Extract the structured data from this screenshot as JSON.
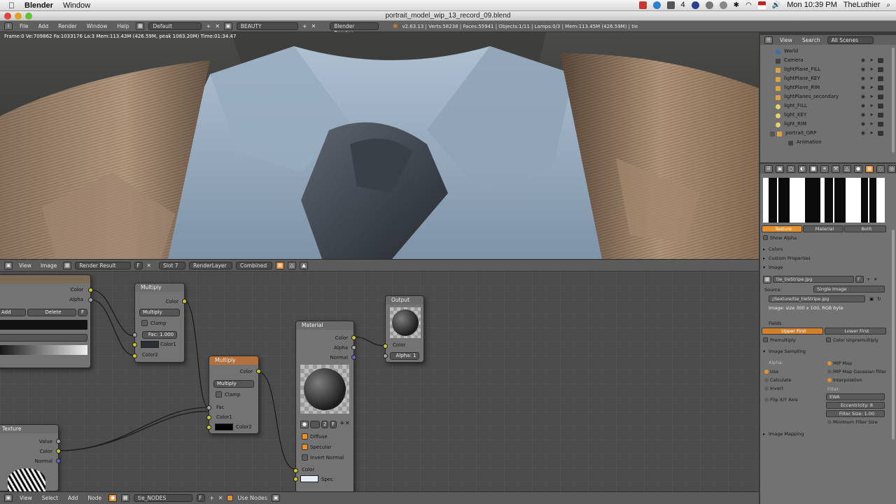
{
  "menubar": {
    "app": "Blender",
    "menus": [
      "Window"
    ],
    "clock": "Mon 10:39 PM",
    "user": "TheLuthier",
    "tray_number": "4"
  },
  "window": {
    "title": "portrait_model_wip_13_record_09.blend"
  },
  "info_header": {
    "menus": [
      "File",
      "Add",
      "Render",
      "Window",
      "Help"
    ],
    "layout": "Default",
    "scene": "BEAUTY",
    "render_engine": "Blender Render",
    "stats": "v2.63.13 | Verts:58238 | Faces:55941 | Objects:1/11 | Lamps:0/3 | Mem:113.45M (426.59M) | tie"
  },
  "viewport": {
    "stats": "Frame:0 Ve:709862 Fa:1033176 La:3 Mem:113.43M (426.59M, peak 1083.20M) Time:01:34.47"
  },
  "image_header": {
    "menus": [
      "View",
      "Image"
    ],
    "image": "Render Result",
    "image_flag": "F",
    "slot": "Slot 7",
    "render_layer": "RenderLayer",
    "pass": "Combined"
  },
  "nodes": {
    "ramp_partial": {
      "color": "Color",
      "alpha": "Alpha",
      "add": "Add",
      "delete": "Delete",
      "f": "F"
    },
    "multiply1": {
      "title": "Multiply",
      "out": "Color",
      "mode": "Multiply",
      "clamp": "Clamp",
      "fac": "Fac: 1.000",
      "color1": "Color1",
      "color2": "Color2"
    },
    "multiply2": {
      "title": "Multiply",
      "out": "Color",
      "mode": "Multiply",
      "clamp": "Clamp",
      "fac": "Fac",
      "color1": "Color1",
      "color2": "Color2"
    },
    "material": {
      "title": "Material",
      "color": "Color",
      "alpha": "Alpha",
      "normal": "Normal",
      "slot": "2",
      "flag": "F",
      "diffuse": "Diffuse",
      "specular": "Specular",
      "invert_normal": "Invert Normal",
      "in_color": "Color",
      "in_spec": "Spec"
    },
    "output": {
      "title": "Output",
      "color": "Color",
      "alpha": "Alpha: 1"
    },
    "texture": {
      "title": "Texture",
      "value": "Value",
      "color": "Color",
      "normal": "Normal"
    }
  },
  "node_footer": {
    "menus": [
      "View",
      "Select",
      "Add",
      "Node"
    ],
    "tree": "tie_NODES",
    "flag": "F",
    "use_nodes": "Use Nodes"
  },
  "outliner": {
    "menus": [
      "View",
      "Search"
    ],
    "filter": "All Scenes",
    "items": [
      "World",
      "Camera",
      "lightPlane_FILL",
      "lightPlane_KEY",
      "lightPlane_RIM",
      "lightPlanes_secondary",
      "light_FILL",
      "light_KEY",
      "light_RIM",
      "portrait_GRP",
      "Animation"
    ]
  },
  "properties": {
    "tabs": [
      "Texture",
      "Material",
      "Both"
    ],
    "show_alpha": "Show Alpha",
    "sections": {
      "colors": "Colors",
      "custom_properties": "Custom Properties",
      "image": "Image",
      "fields": "Fields",
      "image_sampling": "Image Sampling",
      "image_mapping": "Image Mapping"
    },
    "image_name": "tie_tieStripe.jpg",
    "image_flag": "F",
    "source_label": "Source:",
    "source": "Single Image",
    "filepath": "//texture/tie_tieStripe.jpg",
    "image_size": "Image: size 300 x 100, RGB byte",
    "upper_first": "Upper First",
    "lower_first": "Lower First",
    "premultiply": "Premultiply",
    "color_unpremultiply": "Color Unpremultiply",
    "alpha_label": "Alpha:",
    "use": "Use",
    "calculate": "Calculate",
    "invert": "Invert",
    "flip_xy": "Flip X/Y Axis",
    "mip_map": "MIP Map",
    "mip_gauss": "MIP Map Gaussian filter",
    "interpolation": "Interpolation",
    "filter_label": "Filter:",
    "filter": "EWA",
    "eccentricity": "Eccentricity: 8",
    "filter_size": "Filter Size: 1.00",
    "min_filter": "Minimum Filter Size"
  }
}
